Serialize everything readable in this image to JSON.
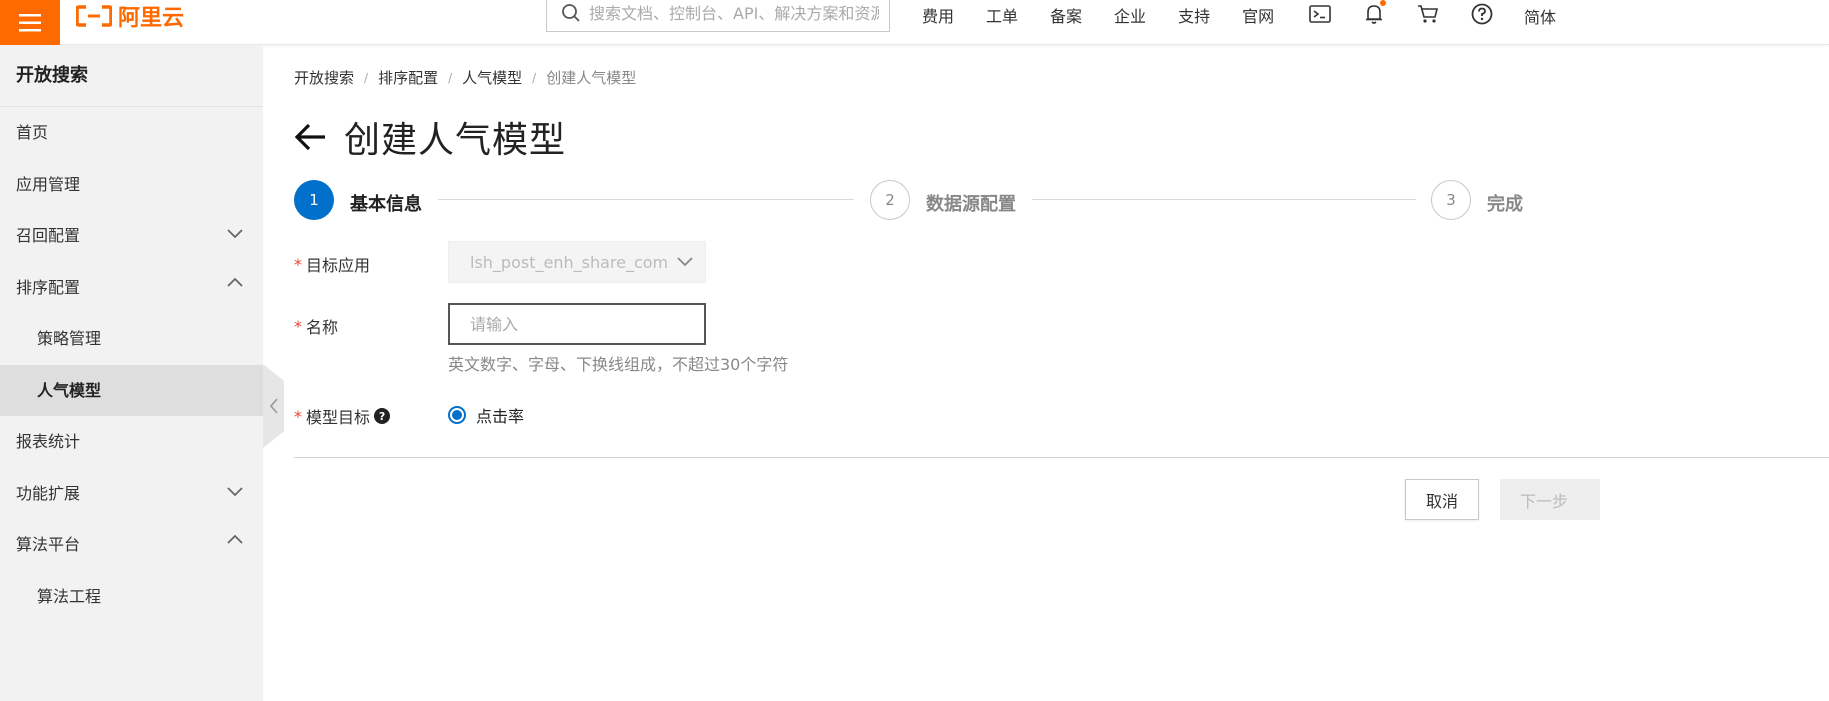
{
  "topbar": {
    "logo_text": "阿里云",
    "search_placeholder": "搜索文档、控制台、API、解决方案和资源",
    "nav": [
      "费用",
      "工单",
      "备案",
      "企业",
      "支持",
      "官网"
    ],
    "icons": [
      "terminal-icon",
      "bell-icon",
      "cart-icon",
      "help-icon"
    ],
    "lang": "简体",
    "accent_color": "#ff6a00"
  },
  "sidebar": {
    "title": "开放搜索",
    "items": [
      {
        "label": "首页"
      },
      {
        "label": "应用管理"
      },
      {
        "label": "召回配置"
      },
      {
        "label": "排序配置"
      },
      {
        "label": "策略管理"
      },
      {
        "label": "人气模型"
      },
      {
        "label": "报表统计"
      },
      {
        "label": "功能扩展"
      },
      {
        "label": "算法平台"
      },
      {
        "label": "算法工程"
      }
    ]
  },
  "breadcrumb": [
    "开放搜索",
    "排序配置",
    "人气模型",
    "创建人气模型"
  ],
  "page": {
    "title": "创建人气模型"
  },
  "steps": [
    {
      "number": "1",
      "label": "基本信息",
      "state": "active"
    },
    {
      "number": "2",
      "label": "数据源配置",
      "state": "inactive"
    },
    {
      "number": "3",
      "label": "完成",
      "state": "inactive"
    }
  ],
  "form": {
    "required_mark": "*",
    "target_app_label": "目标应用",
    "target_app_value": "lsh_post_enh_share_com...",
    "name_label": "名称",
    "name_placeholder": "请输入",
    "name_hint": "英文数字、字母、下换线组成，不超过30个字符",
    "model_target_label": "模型目标",
    "help_glyph": "?",
    "radio_option": "点击率"
  },
  "actions": {
    "cancel": "取消",
    "next": "下一步"
  },
  "colors": {
    "primary": "#0070cc",
    "required": "#e84738"
  }
}
